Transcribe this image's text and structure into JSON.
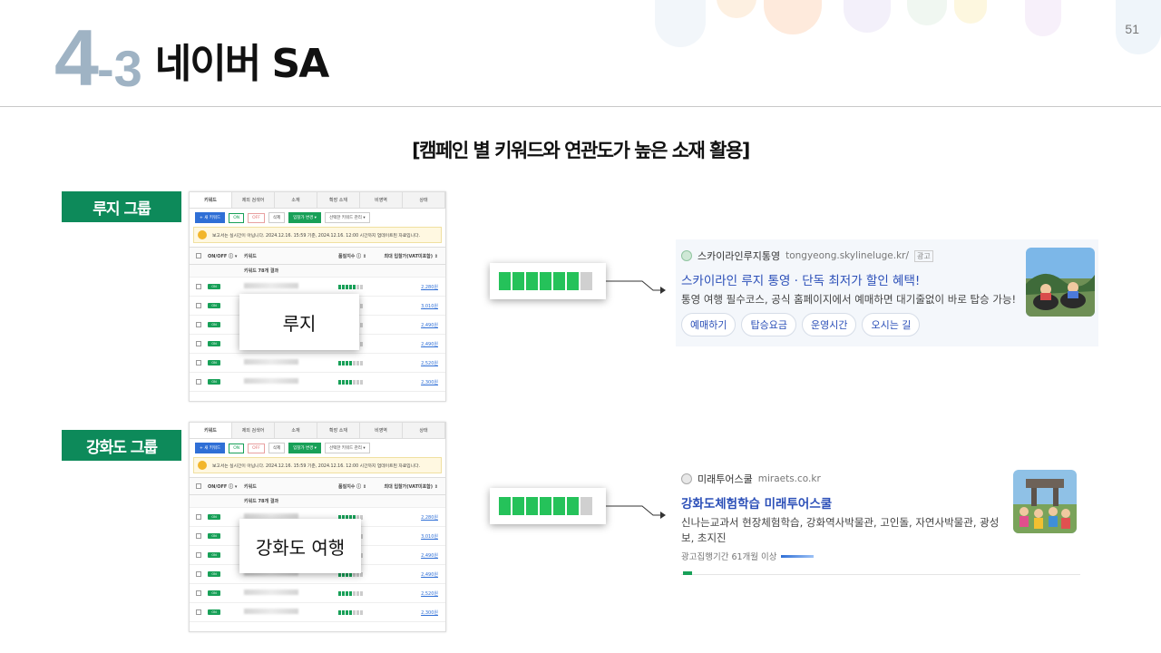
{
  "slide": {
    "number": "51"
  },
  "title": {
    "number": "4",
    "sub": "-3",
    "text": "네이버 SA"
  },
  "subtitle": "[캠페인 별 키워드와 연관도가 높은 소재 활용]",
  "colors": {
    "accent_green": "#0d8a5a",
    "title_blue_gray": "#9fb3c4",
    "meter_green": "#25c25a",
    "link_blue": "#2b4fb8"
  },
  "table": {
    "tabs": [
      "키워드",
      "제외 검색어",
      "소재",
      "확장 소재",
      "비영역",
      "상태"
    ],
    "toolbar": {
      "new_keyword": "+ 새 키워드",
      "on": "ON",
      "off": "OFF",
      "delete": "삭제",
      "bid_change": "입찰가 변경 ▾",
      "selected_action": "선택한 키워드 관리 ▾"
    },
    "notice": "보고서는 실시간이 아닙니다. 2024.12.16. 15:59 기준, 2024.12.16. 12:00 시간까지 업데이트된 자료입니다.",
    "headers": {
      "onoff": "ON/OFF ⓘ ▾",
      "keyword": "키워드",
      "quality": "품질지수 ⓘ ⇕",
      "bid": "최대 입찰가(VAT미포함) ⇕"
    },
    "summary": "키워드 78개 결과",
    "rows": [
      {
        "toggle": "ON",
        "quality": 5,
        "bid": "2,280원"
      },
      {
        "toggle": "ON",
        "quality": 5,
        "bid": "3,010원"
      },
      {
        "toggle": "ON",
        "quality": 5,
        "bid": "2,490원"
      },
      {
        "toggle": "ON",
        "quality": 4,
        "bid": "2,490원"
      },
      {
        "toggle": "ON",
        "quality": 4,
        "bid": "2,520원"
      },
      {
        "toggle": "ON",
        "quality": 4,
        "bid": "2,300원"
      }
    ]
  },
  "groups": [
    {
      "label": "루지 그룹",
      "keyword_overlay": "루지",
      "meter": {
        "filled": 6,
        "total": 7
      },
      "ad": {
        "advertiser": "스카이라인루지통영",
        "url": "tongyeong.skylineluge.kr/",
        "badge": "광고",
        "title": "스카이라인 루지 통영 · 단독 최저가 할인 혜택!",
        "description": "통영 여행 필수코스, 공식 홈페이지에서 예매하면 대기줄없이 바로 탑승 가능!",
        "chips": [
          "예매하기",
          "탑승요금",
          "운영시간",
          "오시는 길"
        ]
      }
    },
    {
      "label": "강화도 그룹",
      "keyword_overlay": "강화도 여행",
      "meter": {
        "filled": 6,
        "total": 7
      },
      "ad": {
        "advertiser": "미래투어스쿨",
        "url": "miraets.co.kr",
        "title": "강화도체험학습 미래투어스쿨",
        "description": "신나는교과서 현장체험학습, 강화역사박물관, 고인돌, 자연사박물관, 광성보, 초지진",
        "meta": "광고집행기간 61개월 이상"
      }
    }
  ]
}
